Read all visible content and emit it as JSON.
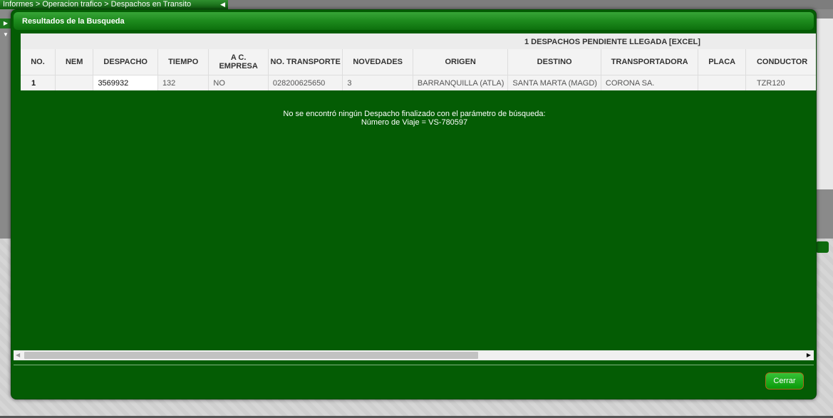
{
  "background": {
    "breadcrumb": "Informes > Operacion trafico > Despachos en Transito"
  },
  "modal": {
    "title": "Resultados de la Busqueda",
    "summary": "1 DESPACHOS PENDIENTE LLEGADA [EXCEL]",
    "columns": [
      "NO.",
      "NEM",
      "DESPACHO",
      "TIEMPO",
      "A C. EMPRESA",
      "NO. TRANSPORTE",
      "NOVEDADES",
      "ORIGEN",
      "DESTINO",
      "TRANSPORTADORA",
      "PLACA",
      "CONDUCTOR"
    ],
    "rows": [
      [
        "1",
        "",
        "3569932",
        "132",
        "NO",
        "028200625650",
        "3",
        "BARRANQUILLA (ATLA)",
        "SANTA MARTA (MAGD)",
        "CORONA SA.",
        "",
        "TZR120"
      ]
    ],
    "message_line1": "No se encontró ningún Despacho finalizado con el parámetro de búsqueda:",
    "message_line2": "Número de Viaje = VS-780597",
    "close_label": "Cerrar"
  },
  "colors": {
    "modal_bg": "#045c04",
    "header_green": "#1d8a1d",
    "button_green": "#0a9a0a"
  }
}
